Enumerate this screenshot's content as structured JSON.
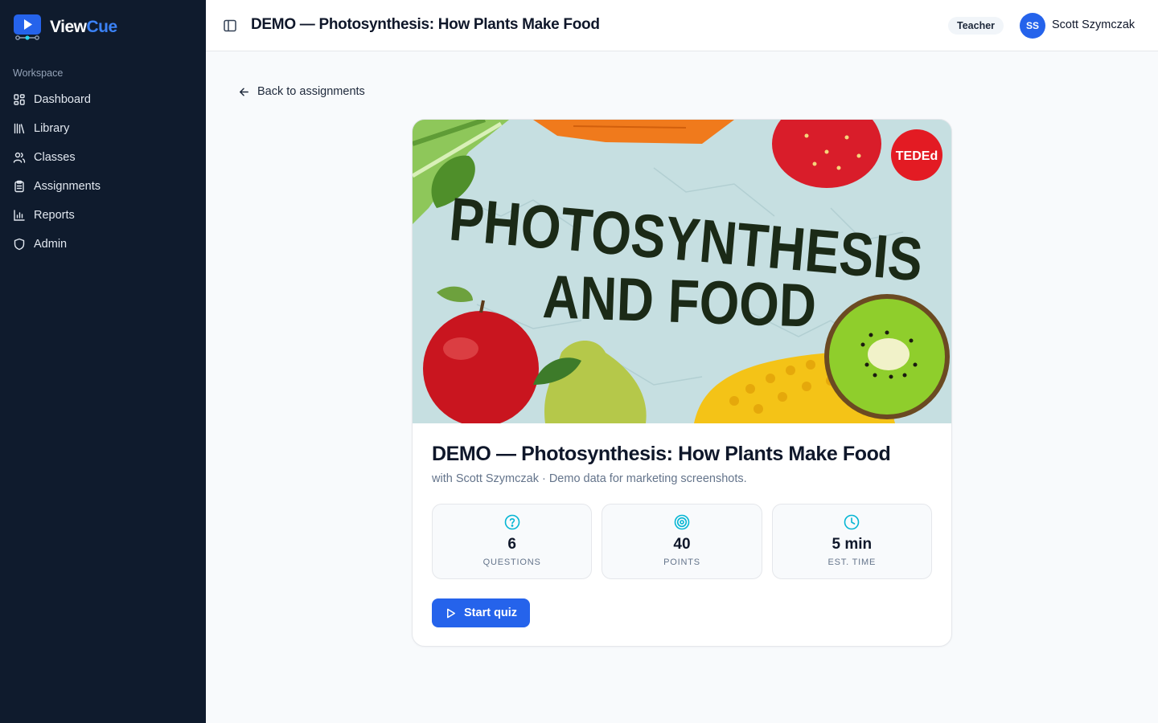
{
  "brand": {
    "name_part1": "View",
    "name_part2": "Cue",
    "accent_color": "#3b82f6"
  },
  "sidebar": {
    "section_label": "Workspace",
    "items": [
      {
        "label": "Dashboard",
        "icon": "layout-grid-icon"
      },
      {
        "label": "Library",
        "icon": "library-icon"
      },
      {
        "label": "Classes",
        "icon": "users-icon"
      },
      {
        "label": "Assignments",
        "icon": "clipboard-icon"
      },
      {
        "label": "Reports",
        "icon": "bar-chart-icon"
      },
      {
        "label": "Admin",
        "icon": "shield-icon"
      }
    ]
  },
  "header": {
    "title": "DEMO — Photosynthesis: How Plants Make Food",
    "role": "Teacher",
    "user_initials": "SS",
    "user_name": "Scott Szymczak"
  },
  "main": {
    "back_label": "Back to assignments",
    "thumbnail": {
      "line1": "PHOTOSYNTHESIS",
      "line2": "AND FOOD",
      "badge": "TEDEd"
    },
    "quiz": {
      "title": "DEMO — Photosynthesis: How Plants Make Food",
      "subtitle": "with Scott Szymczak · Demo data for marketing screenshots.",
      "stats": [
        {
          "value": "6",
          "label": "Questions",
          "icon": "help-circle-icon"
        },
        {
          "value": "40",
          "label": "Points",
          "icon": "target-icon"
        },
        {
          "value": "5 min",
          "label": "Est. time",
          "icon": "clock-icon"
        }
      ],
      "start_label": "Start quiz"
    }
  },
  "colors": {
    "primary": "#2563eb",
    "sidebar_bg": "#0f1b2d",
    "icon_accent": "#06b6d4"
  }
}
